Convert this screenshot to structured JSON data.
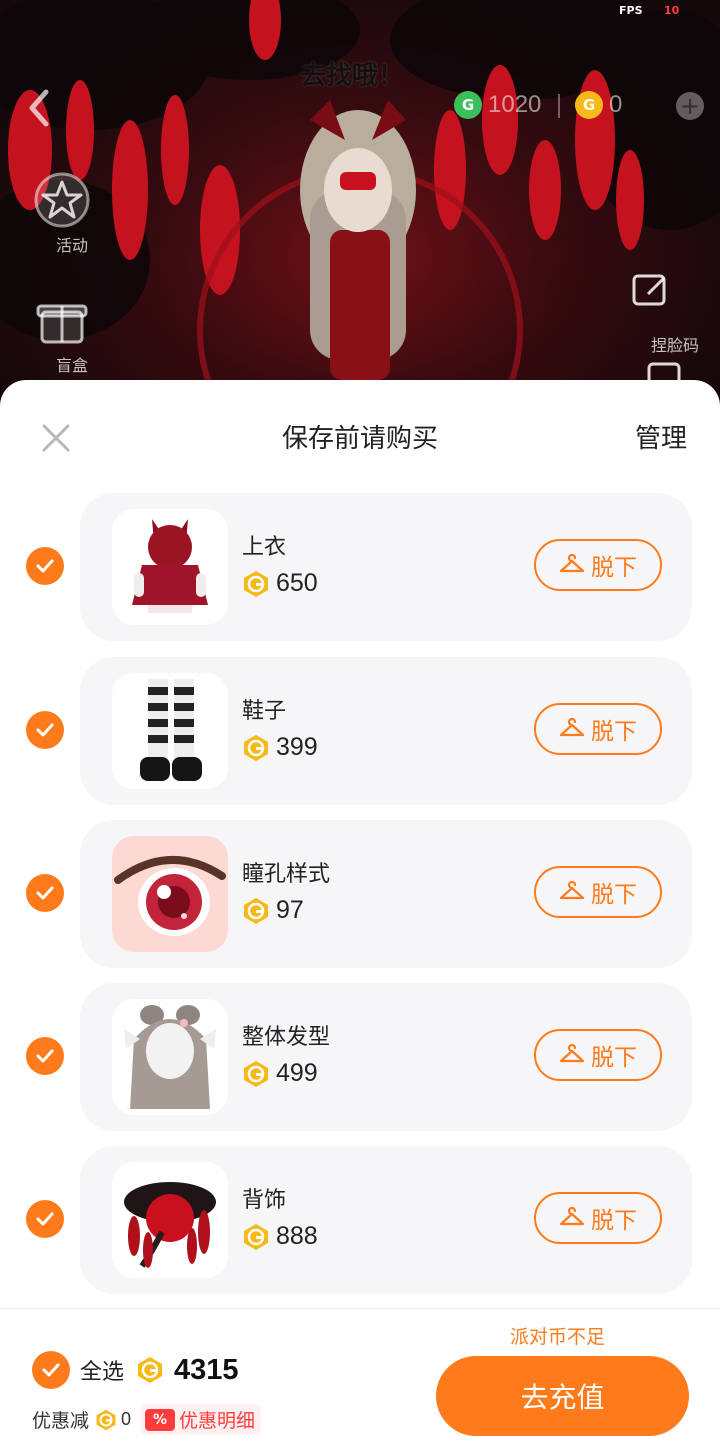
{
  "status": {
    "fps_label": "FPS",
    "fps_value": "10"
  },
  "scene": {
    "title": "去找哦！",
    "green_currency": "1020",
    "gold_currency": "0",
    "side_buttons": {
      "activity": "活动",
      "blind_box": "盲盒",
      "face_code": "捏脸码"
    }
  },
  "sheet": {
    "title": "保存前请购买",
    "manage": "管理",
    "takeoff_label": "脱下",
    "items": [
      {
        "name": "上衣",
        "price": "650",
        "icon": "red-hooded-dress-thumb"
      },
      {
        "name": "鞋子",
        "price": "399",
        "icon": "striped-socks-shoes-thumb"
      },
      {
        "name": "瞳孔样式",
        "price": "97",
        "icon": "red-eye-thumb"
      },
      {
        "name": "整体发型",
        "price": "499",
        "icon": "gray-hair-thumb"
      },
      {
        "name": "背饰",
        "price": "888",
        "icon": "red-tree-back-accessory-thumb"
      }
    ],
    "insufficient": "派对币不足",
    "select_all": "全选",
    "total": "4315",
    "discount_label": "优惠减",
    "discount_value": "0",
    "discount_badge": "%",
    "discount_detail": "优惠明细",
    "recharge": "去充值"
  },
  "colors": {
    "accent": "#ff7a1a",
    "coin_gold": "#f6b91a",
    "coin_green": "#3cbf5a",
    "discount_red": "#ff3b3b"
  }
}
